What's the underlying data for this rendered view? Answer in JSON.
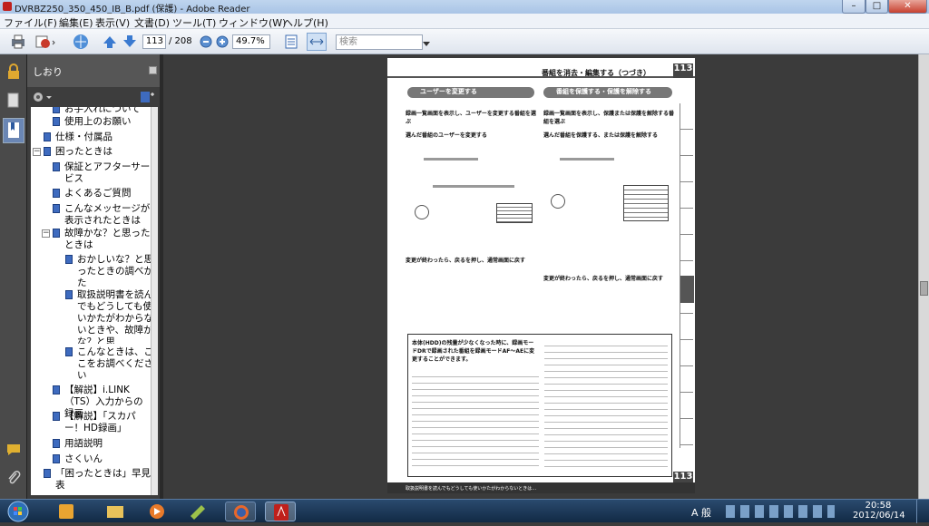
{
  "window": {
    "title": "DVRBZ250_350_450_IB_B.pdf (保護) - Adobe Reader",
    "minimize": "–",
    "maximize": "□",
    "close": "✕"
  },
  "menu": [
    "ファイル(F)",
    "編集(E)",
    "表示(V)",
    "文書(D)",
    "ツール(T)",
    "ウィンドウ(W)",
    "ヘルプ(H)"
  ],
  "toolbar": {
    "page_current": "113",
    "page_total": "/ 208",
    "zoom": "49.7%",
    "search_placeholder": "検索"
  },
  "bookmarks": {
    "title": "しおり",
    "items": [
      {
        "label": "お手入れについて",
        "level": 2
      },
      {
        "label": "使用上のお願い",
        "level": 2
      },
      {
        "label": "仕様・付属品",
        "level": 1
      },
      {
        "label": "困ったときは",
        "level": 0
      },
      {
        "label": "保証とアフターサービス",
        "level": 1
      },
      {
        "label": "よくあるご質問",
        "level": 1
      },
      {
        "label": "こんなメッセージが表示されたときは",
        "level": 1
      },
      {
        "label": "故障かな？と思ったときは",
        "level": 1
      },
      {
        "label": "おかしいな？と思ったときの調べかた",
        "level": 2
      },
      {
        "label": "取扱説明書を読んでもどうしても使いかたがわからないときや、故障かな？と思",
        "level": 2
      },
      {
        "label": "こんなときは、ここをお調べください",
        "level": 2
      },
      {
        "label": "【解説】i.LINK（TS）入力からの録画",
        "level": 1
      },
      {
        "label": "【解説】「スカパー！HD録画」",
        "level": 1
      },
      {
        "label": "用語説明",
        "level": 1
      },
      {
        "label": "さくいん",
        "level": 1
      },
      {
        "label": "「困ったときは」早見表",
        "level": 0
      }
    ]
  },
  "pdf": {
    "header": "番組を消去・編集する（つづき）",
    "page_number": "113",
    "left_section": "ユーザーを変更する",
    "right_section": "番組を保護する・保護を解除する",
    "step1_left": "録画一覧画面を表示し、ユーザーを変更する番組を選ぶ",
    "step2_left": "選んだ番組のユーザーを変更する",
    "step3_left": "変更が終わったら、戻るを押し、通常画面に戻す",
    "step1_right": "録画一覧画面を表示し、保護または保護を解除する番組を選ぶ",
    "step2_right": "選んだ番組を保護する、または保護を解除する",
    "step3_right": "変更が終わったら、戻るを押し、通常画面に戻す",
    "box_title": "本体(HDD)の残量が少なくなった時に、録画モードDRで録画された番組を録画モードAF～AEに変更することができます。",
    "footer": "取扱説明書を読んでもどうしても使いかたがわからないときは…"
  },
  "taskbar": {
    "time": "20:58",
    "date": "2012/06/14",
    "ime": "A 般"
  }
}
